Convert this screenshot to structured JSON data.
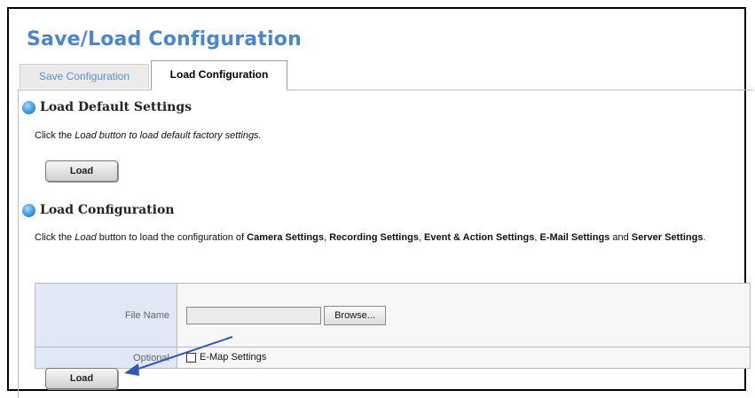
{
  "page": {
    "title": "Save/Load Configuration"
  },
  "tabs": [
    {
      "label": "Save Configuration",
      "active": false
    },
    {
      "label": "Load Configuration",
      "active": true
    }
  ],
  "default_section": {
    "heading": "Load Default Settings",
    "desc_pre": "Click the ",
    "desc_em": "Load button to load default factory settings.",
    "button": "Load"
  },
  "config_section": {
    "heading": "Load Configuration",
    "desc_pre": "Click the ",
    "desc_em": "Load",
    "desc_mid": " button to load the configuration of ",
    "b1": "Camera Settings",
    "c1": ", ",
    "b2": "Recording Settings",
    "c2": ", ",
    "b3": "Event & Action Settings",
    "c3": ", ",
    "b4": "E-Mail Settings",
    "and": " and ",
    "b5": "Server Settings",
    "end": ".",
    "file_label": "File Name",
    "file_value": "",
    "browse_button": "Browse...",
    "optional_label": "Optional",
    "emap_label": "E-Map Settings",
    "emap_checked": false,
    "button": "Load"
  },
  "colors": {
    "title": "#4a86c9",
    "label_bg": "#dfe8f4",
    "arrow": "#2f57b5"
  }
}
